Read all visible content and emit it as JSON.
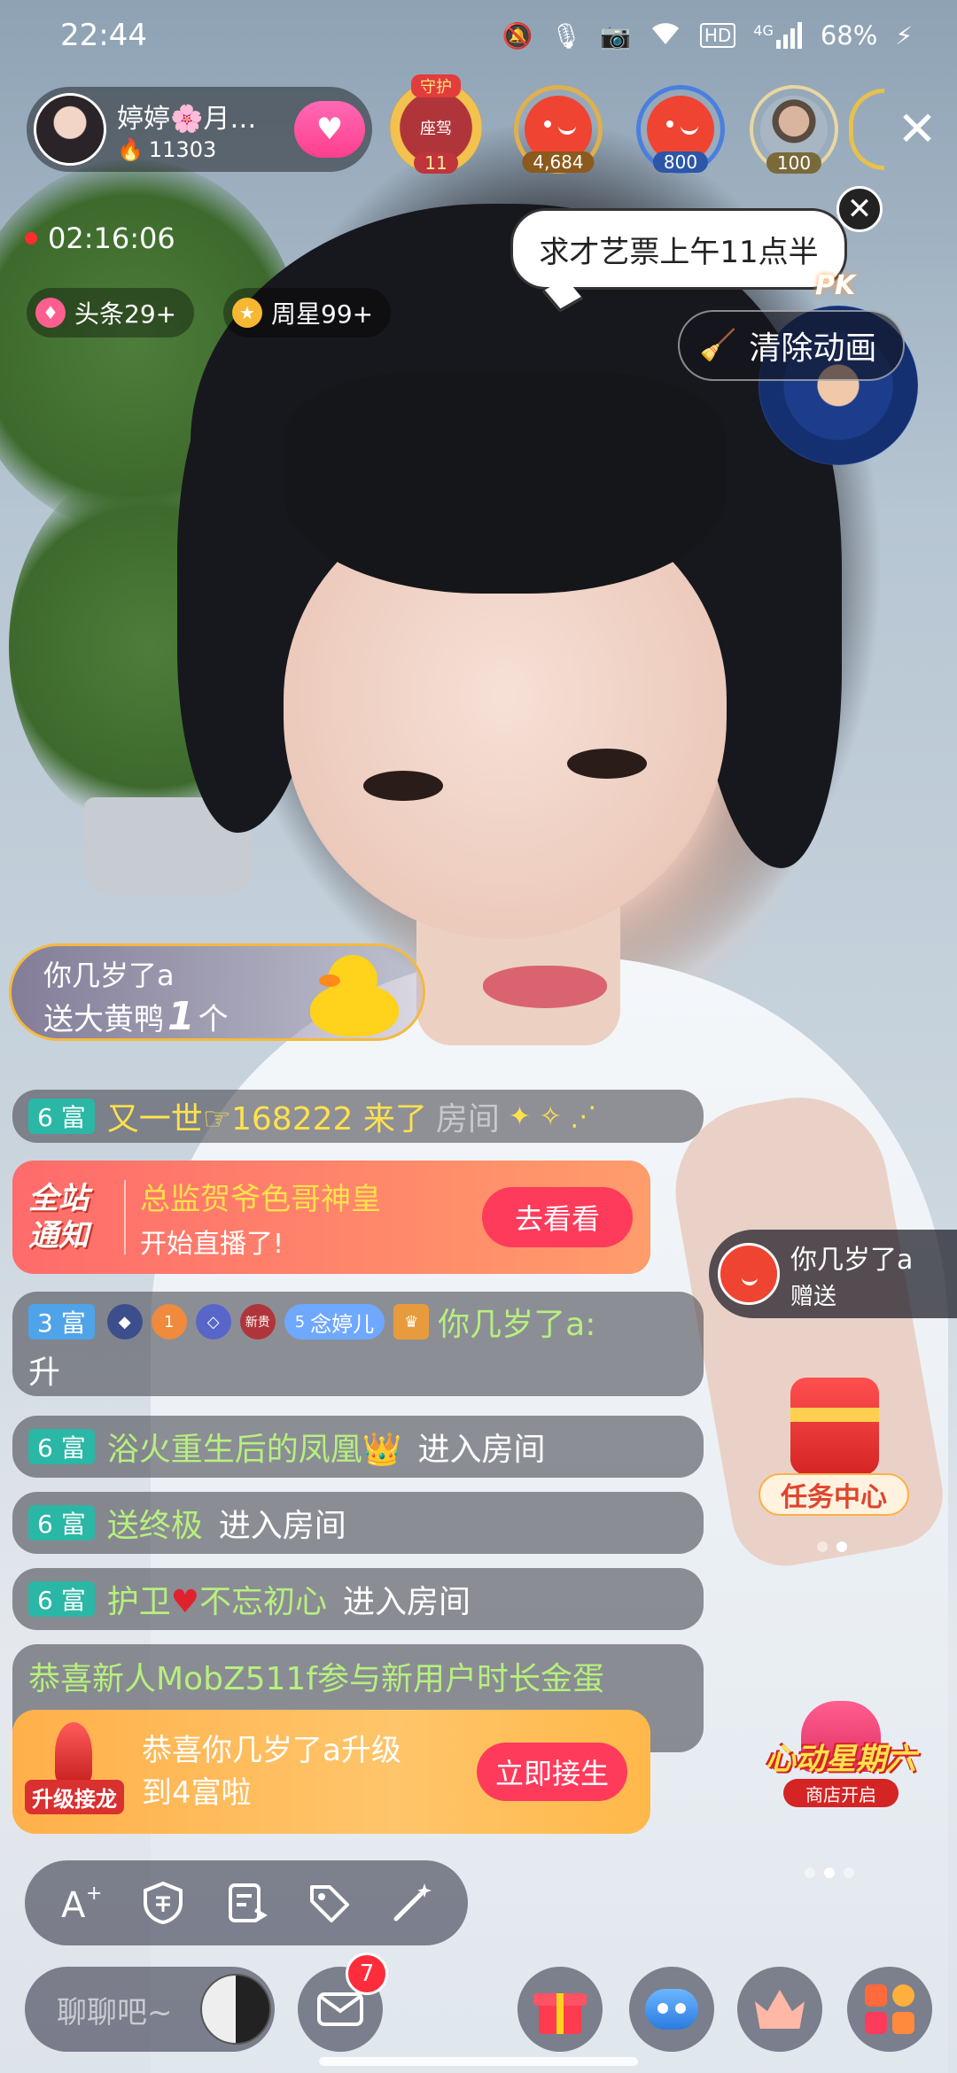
{
  "status_bar": {
    "time": "22:44",
    "icons": [
      "mute-icon",
      "mic-icon",
      "camera-icon",
      "wifi-icon",
      "hd-icon",
      "4g-signal-icon",
      "charging-icon"
    ],
    "hd": "HD",
    "net": "4G",
    "battery": "68%"
  },
  "host": {
    "name": "婷婷🌸月…",
    "score": "11303"
  },
  "guard": {
    "top": "守护",
    "title": "座驾",
    "level": "11"
  },
  "viewers": [
    {
      "value": "4,684"
    },
    {
      "value": "800"
    },
    {
      "value": "100"
    }
  ],
  "close_symbol": "✕",
  "live": {
    "duration": "02:16:06"
  },
  "tags": [
    {
      "label": "头条29+"
    },
    {
      "label": "周星99+"
    }
  ],
  "bubble": {
    "text": "求才艺票上午11点半",
    "close": "✕"
  },
  "pk_label": "PK",
  "clear_animation": "清除动画",
  "gift_banner": {
    "sender": "你几岁了a",
    "action": "送大黄鸭",
    "count": "1",
    "unit": "个"
  },
  "chat": {
    "line1": {
      "level": "6 富",
      "text": "又一世☞168222 来了",
      "tail": "房间"
    },
    "notice": {
      "logo_line1": "全站",
      "logo_line2": "通知",
      "title": "总监贺爷色哥神皇",
      "subtitle": "开始直播了!",
      "button": "去看看"
    },
    "line3": {
      "level": "3 富",
      "fan": "念婷儿",
      "fan_level": "5",
      "name": "你几岁了a:",
      "body": "升",
      "medal_new": "新贵",
      "medal_rank": "1"
    },
    "line4": {
      "level": "6 富",
      "name": "浴火重生后的凤凰👑",
      "action": "进入房间"
    },
    "line5": {
      "level": "6 富",
      "name": "送终极",
      "action": "进入房间"
    },
    "line6": {
      "level": "6 富",
      "name_a": "护卫",
      "name_b": "不忘初心",
      "action": "进入房间",
      "heart": "♥"
    },
    "line7": {
      "text": "恭喜新人MobZ511f参与新用户时长金蛋"
    }
  },
  "upgrade": {
    "logo": "升级接龙",
    "line1": "恭喜你几岁了a升级",
    "line2": "到4富啦",
    "button": "立即接生"
  },
  "gift_float": {
    "name": "你几岁了a",
    "action": "赠送"
  },
  "task_center": "任务中心",
  "promo": {
    "title": "心动星期六",
    "subtitle": "商店开启"
  },
  "bottom": {
    "chat_placeholder": "聊聊吧~",
    "mail_badge": "7"
  }
}
